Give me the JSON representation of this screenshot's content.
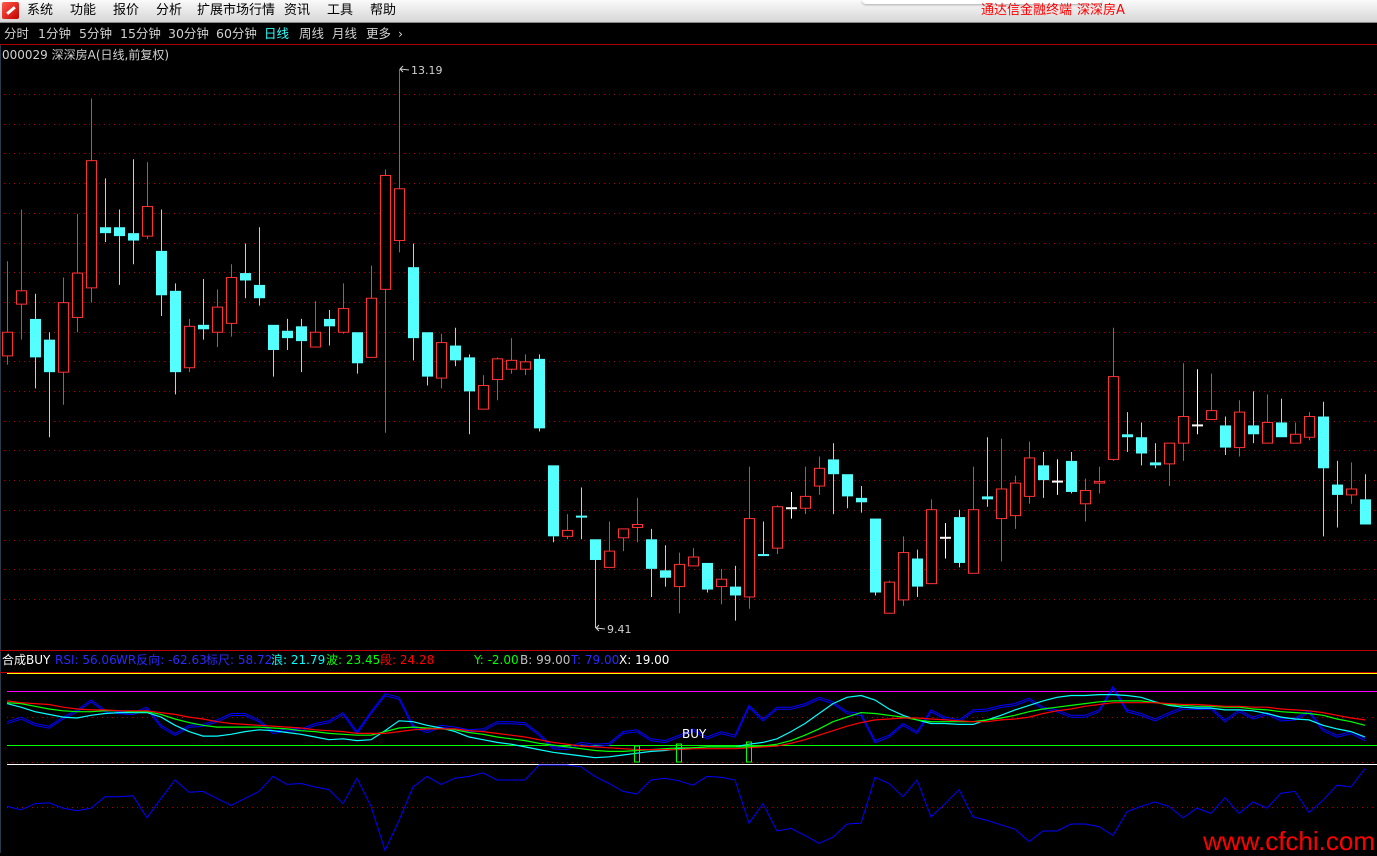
{
  "menubar": {
    "items": [
      "系统",
      "功能",
      "报价",
      "分析",
      "扩展市场行情",
      "资讯",
      "工具",
      "帮助"
    ],
    "app_title": "通达信金融终端",
    "stock_name": "深深房A"
  },
  "periods": {
    "items": [
      "分时",
      "1分钟",
      "5分钟",
      "15分钟",
      "30分钟",
      "60分钟",
      "日线",
      "周线",
      "月线",
      "更多",
      "›"
    ],
    "active": "日线"
  },
  "stock_title": "000029 深深房A(日线,前复权)",
  "indicator_header": {
    "name": "合成BUY",
    "rsi": "RSI: 56.06",
    "wr": "WR反向: -62.63",
    "ruler": "标尺: 58.72",
    "lang": "浪: 21.79",
    "bo": "波: 23.45",
    "duan": "段: 24.28",
    "y": "Y: -2.00",
    "b": "B: 99.00",
    "t": "T: 79.00",
    "x": "X: 19.00"
  },
  "buy_label": "BUY",
  "watermark": "www.cfchi.com",
  "colors": {
    "up": "#ff3232",
    "down": "#54ffff",
    "flat": "#ffffff",
    "grid": "#a00000",
    "rsi": "#0000ff",
    "cyan": "#00ffff",
    "green": "#00ff00",
    "red": "#ff0000"
  },
  "chart_data": [
    {
      "type": "candlestick",
      "title": "000029 深深房A(日线,前复权)",
      "ylim": [
        9.41,
        13.19
      ],
      "max_label": "13.19",
      "min_label": "9.41",
      "max_index": 28,
      "min_index": 42,
      "candles_ohlc": [
        [
          11.25,
          11.89,
          11.19,
          11.41
        ],
        [
          11.6,
          12.24,
          11.36,
          11.69
        ],
        [
          11.5,
          11.67,
          11.03,
          11.24
        ],
        [
          11.36,
          11.41,
          10.7,
          11.14
        ],
        [
          11.14,
          11.78,
          10.92,
          11.61
        ],
        [
          11.51,
          12.21,
          11.41,
          11.81
        ],
        [
          11.71,
          12.99,
          11.61,
          12.57
        ],
        [
          12.12,
          12.45,
          12.02,
          12.08
        ],
        [
          12.12,
          12.24,
          11.73,
          12.06
        ],
        [
          12.08,
          12.58,
          11.87,
          12.03
        ],
        [
          12.06,
          12.56,
          12.04,
          12.26
        ],
        [
          11.96,
          12.24,
          11.52,
          11.66
        ],
        [
          11.69,
          11.74,
          10.99,
          11.14
        ],
        [
          11.17,
          11.5,
          11.14,
          11.45
        ],
        [
          11.46,
          11.77,
          11.36,
          11.43
        ],
        [
          11.41,
          11.7,
          11.31,
          11.58
        ],
        [
          11.47,
          11.87,
          11.38,
          11.78
        ],
        [
          11.81,
          12.01,
          11.64,
          11.76
        ],
        [
          11.73,
          12.12,
          11.59,
          11.64
        ],
        [
          11.46,
          11.46,
          11.11,
          11.29
        ],
        [
          11.42,
          11.5,
          11.29,
          11.37
        ],
        [
          11.45,
          11.5,
          11.14,
          11.35
        ],
        [
          11.31,
          11.62,
          11.31,
          11.41
        ],
        [
          11.5,
          11.56,
          11.32,
          11.45
        ],
        [
          11.41,
          11.74,
          11.4,
          11.57
        ],
        [
          11.41,
          11.41,
          11.13,
          11.2
        ],
        [
          11.24,
          11.86,
          11.24,
          11.64
        ],
        [
          11.7,
          12.51,
          10.73,
          12.47
        ],
        [
          12.03,
          13.19,
          11.95,
          12.38
        ],
        [
          11.85,
          12.01,
          11.22,
          11.37
        ],
        [
          11.41,
          11.41,
          11.05,
          11.11
        ],
        [
          11.1,
          11.4,
          11.03,
          11.34
        ],
        [
          11.32,
          11.44,
          11.18,
          11.22
        ],
        [
          11.24,
          11.26,
          10.72,
          11.01
        ],
        [
          10.89,
          11.12,
          10.89,
          11.05
        ],
        [
          11.09,
          11.24,
          10.95,
          11.23
        ],
        [
          11.16,
          11.37,
          11.13,
          11.22
        ],
        [
          11.16,
          11.26,
          11.12,
          11.21
        ],
        [
          11.23,
          11.26,
          10.74,
          10.76
        ],
        [
          10.51,
          10.51,
          9.99,
          10.03
        ],
        [
          10.03,
          10.18,
          10.01,
          10.07
        ],
        [
          10.17,
          10.36,
          10.01,
          10.16
        ],
        [
          10.01,
          10.01,
          9.41,
          9.87
        ],
        [
          9.82,
          10.13,
          9.82,
          9.93
        ],
        [
          10.02,
          10.08,
          9.93,
          10.08
        ],
        [
          10.09,
          10.29,
          9.99,
          10.11
        ],
        [
          10.01,
          10.08,
          9.62,
          9.81
        ],
        [
          9.8,
          9.97,
          9.69,
          9.75
        ],
        [
          9.69,
          9.92,
          9.51,
          9.84
        ],
        [
          9.83,
          9.95,
          9.83,
          9.89
        ],
        [
          9.85,
          9.85,
          9.65,
          9.67
        ],
        [
          9.69,
          9.81,
          9.57,
          9.74
        ],
        [
          9.69,
          9.83,
          9.46,
          9.63
        ],
        [
          9.62,
          10.5,
          9.54,
          10.15
        ],
        [
          9.91,
          10.13,
          9.9,
          9.9
        ],
        [
          9.95,
          10.24,
          9.91,
          10.23
        ],
        [
          10.22,
          10.33,
          10.15,
          10.22
        ],
        [
          10.22,
          10.5,
          10.18,
          10.3
        ],
        [
          10.37,
          10.57,
          10.31,
          10.49
        ],
        [
          10.55,
          10.66,
          10.18,
          10.45
        ],
        [
          10.45,
          10.45,
          10.22,
          10.3
        ],
        [
          10.29,
          10.37,
          10.19,
          10.26
        ],
        [
          10.15,
          10.15,
          9.63,
          9.65
        ],
        [
          9.51,
          9.73,
          9.51,
          9.72
        ],
        [
          9.6,
          10.03,
          9.56,
          9.92
        ],
        [
          9.88,
          9.94,
          9.62,
          9.69
        ],
        [
          9.71,
          10.28,
          9.71,
          10.21
        ],
        [
          10.02,
          10.12,
          9.88,
          10.02
        ],
        [
          10.16,
          10.21,
          9.82,
          9.85
        ],
        [
          9.78,
          10.5,
          9.78,
          10.21
        ],
        [
          10.3,
          10.7,
          10.23,
          10.28
        ],
        [
          10.15,
          10.69,
          9.86,
          10.35
        ],
        [
          10.17,
          10.44,
          10.08,
          10.39
        ],
        [
          10.3,
          10.67,
          10.25,
          10.56
        ],
        [
          10.51,
          10.6,
          10.29,
          10.41
        ],
        [
          10.4,
          10.55,
          10.31,
          10.4
        ],
        [
          10.54,
          10.6,
          10.32,
          10.33
        ],
        [
          10.25,
          10.42,
          10.13,
          10.34
        ],
        [
          10.39,
          10.5,
          10.32,
          10.4
        ],
        [
          10.55,
          11.44,
          10.54,
          11.11
        ],
        [
          10.72,
          10.87,
          10.6,
          10.7
        ],
        [
          10.7,
          10.8,
          10.51,
          10.59
        ],
        [
          10.53,
          10.66,
          10.49,
          10.51
        ],
        [
          10.52,
          10.66,
          10.37,
          10.66
        ],
        [
          10.66,
          11.2,
          10.54,
          10.84
        ],
        [
          10.78,
          11.16,
          10.72,
          10.78
        ],
        [
          10.82,
          11.13,
          10.82,
          10.88
        ],
        [
          10.78,
          10.84,
          10.58,
          10.63
        ],
        [
          10.63,
          10.95,
          10.57,
          10.87
        ],
        [
          10.78,
          11.01,
          10.66,
          10.72
        ],
        [
          10.66,
          10.99,
          10.66,
          10.8
        ],
        [
          10.8,
          10.96,
          10.7,
          10.7
        ],
        [
          10.66,
          10.8,
          10.66,
          10.72
        ],
        [
          10.7,
          10.87,
          10.68,
          10.84
        ],
        [
          10.84,
          10.94,
          10.03,
          10.49
        ],
        [
          10.38,
          10.54,
          10.09,
          10.31
        ],
        [
          10.31,
          10.53,
          10.25,
          10.35
        ],
        [
          10.28,
          10.45,
          10.11,
          10.11
        ]
      ]
    },
    {
      "type": "line",
      "title": "合成BUY",
      "ylim": [
        -2,
        99
      ],
      "reference_levels": {
        "B": 99,
        "T": 79,
        "X": 19,
        "Y": -2
      },
      "buy_signal_indices": [
        45,
        48,
        53
      ],
      "series": [
        {
          "name": "RSI",
          "style": "double-blue",
          "values": [
            45,
            50,
            43,
            40,
            50,
            58,
            69,
            58,
            56,
            55,
            61,
            41,
            32,
            41,
            42,
            47,
            54,
            54,
            47,
            34,
            37,
            37,
            43,
            46,
            55,
            34,
            56,
            76,
            72,
            41,
            35,
            41,
            39,
            36,
            37,
            45,
            45,
            44,
            32,
            17,
            16,
            22,
            20,
            21,
            34,
            36,
            26,
            24,
            30,
            37,
            28,
            34,
            30,
            63,
            48,
            61,
            61,
            65,
            72,
            67,
            56,
            54,
            24,
            30,
            43,
            34,
            58,
            50,
            47,
            58,
            59,
            63,
            65,
            71,
            61,
            58,
            52,
            52,
            58,
            84,
            58,
            54,
            48,
            55,
            61,
            61,
            61,
            47,
            58,
            50,
            55,
            48,
            49,
            57,
            37,
            30,
            34,
            26
          ]
        },
        {
          "name": "浪",
          "color": "cyan",
          "values": [
            65,
            61,
            56,
            53,
            50,
            49,
            52,
            54,
            55,
            55,
            55,
            50,
            41,
            34,
            29,
            29,
            31,
            34,
            36,
            35,
            33,
            31,
            28,
            25,
            26,
            24,
            25,
            35,
            46,
            45,
            41,
            38,
            34,
            28,
            25,
            22,
            20,
            17,
            14,
            11,
            9,
            7,
            5,
            6,
            8,
            10,
            12,
            13,
            15,
            16,
            17,
            17,
            17,
            20,
            22,
            26,
            34,
            43,
            54,
            65,
            72,
            74,
            69,
            59,
            52,
            47,
            43,
            43,
            42,
            42,
            47,
            52,
            58,
            63,
            68,
            72,
            74,
            74,
            75,
            75,
            74,
            72,
            67,
            63,
            61,
            60,
            60,
            58,
            58,
            57,
            54,
            50,
            48,
            47,
            41,
            37,
            34,
            28
          ]
        },
        {
          "name": "波",
          "color": "green",
          "values": [
            66,
            65,
            62,
            59,
            57,
            56,
            56,
            57,
            57,
            56,
            56,
            53,
            48,
            44,
            41,
            39,
            39,
            39,
            39,
            38,
            37,
            35,
            34,
            32,
            31,
            30,
            30,
            34,
            38,
            39,
            38,
            37,
            36,
            33,
            31,
            28,
            26,
            24,
            21,
            19,
            17,
            15,
            13,
            12,
            12,
            13,
            14,
            15,
            16,
            16,
            17,
            17,
            17,
            17,
            18,
            20,
            24,
            30,
            37,
            45,
            50,
            55,
            54,
            52,
            50,
            47,
            45,
            45,
            45,
            45,
            47,
            49,
            52,
            56,
            59,
            61,
            63,
            65,
            67,
            68,
            68,
            68,
            66,
            64,
            63,
            62,
            62,
            61,
            61,
            59,
            58,
            56,
            55,
            54,
            52,
            48,
            45,
            41
          ]
        },
        {
          "name": "段",
          "color": "red",
          "values": [
            68,
            66,
            65,
            64,
            61,
            59,
            58,
            58,
            57,
            57,
            57,
            55,
            53,
            50,
            48,
            45,
            43,
            42,
            41,
            40,
            39,
            38,
            36,
            35,
            34,
            32,
            32,
            32,
            34,
            36,
            37,
            37,
            37,
            35,
            34,
            32,
            30,
            28,
            25,
            22,
            20,
            18,
            17,
            16,
            15,
            14,
            14,
            14,
            14,
            15,
            15,
            15,
            15,
            16,
            17,
            18,
            21,
            25,
            30,
            35,
            40,
            44,
            47,
            48,
            49,
            49,
            48,
            47,
            46,
            45,
            45,
            47,
            48,
            50,
            54,
            57,
            59,
            62,
            64,
            66,
            66,
            66,
            66,
            65,
            64,
            64,
            63,
            62,
            62,
            61,
            61,
            59,
            58,
            57,
            55,
            52,
            49,
            47
          ]
        }
      ]
    },
    {
      "type": "line",
      "title": "WR反向",
      "ylim": [
        0,
        100
      ],
      "series": [
        {
          "name": "WR反向",
          "color": "blue",
          "values": [
            53,
            49,
            56,
            57,
            51,
            48,
            51,
            64,
            64,
            65,
            40,
            62,
            83,
            69,
            70,
            62,
            54,
            62,
            70,
            87,
            78,
            79,
            75,
            72,
            56,
            85,
            53,
            3,
            37,
            75,
            87,
            78,
            85,
            87,
            91,
            83,
            83,
            83,
            100,
            100,
            100,
            98,
            87,
            79,
            70,
            67,
            83,
            85,
            82,
            77,
            87,
            86,
            83,
            34,
            56,
            25,
            28,
            20,
            11,
            18,
            33,
            34,
            86,
            79,
            64,
            83,
            41,
            56,
            72,
            41,
            37,
            32,
            27,
            13,
            25,
            25,
            33,
            33,
            30,
            20,
            47,
            53,
            58,
            53,
            40,
            51,
            45,
            63,
            45,
            58,
            51,
            68,
            70,
            46,
            60,
            77,
            75,
            96
          ]
        }
      ]
    }
  ]
}
